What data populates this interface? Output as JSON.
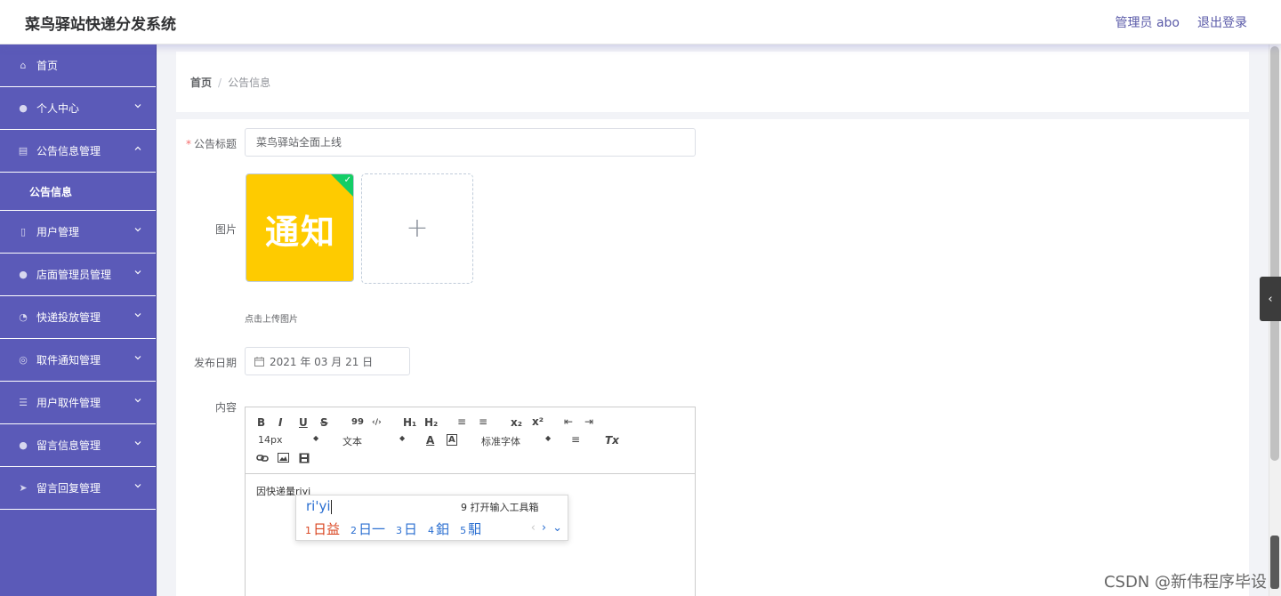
{
  "header": {
    "app_title": "菜鸟驿站快递分发系统",
    "user_label": "管理员 abo",
    "logout_label": "退出登录"
  },
  "sidebar": {
    "items": [
      {
        "label": "首页",
        "icon": "home-icon",
        "expanded": false,
        "has_caret": false
      },
      {
        "label": "个人中心",
        "icon": "user-icon",
        "expanded": false,
        "has_caret": true
      },
      {
        "label": "公告信息管理",
        "icon": "clipboard-icon",
        "expanded": true,
        "has_caret": true
      },
      {
        "label": "用户管理",
        "icon": "microphone-icon",
        "expanded": false,
        "has_caret": true
      },
      {
        "label": "店面管理员管理",
        "icon": "person-icon",
        "expanded": false,
        "has_caret": true
      },
      {
        "label": "快递投放管理",
        "icon": "gauge-icon",
        "expanded": false,
        "has_caret": true
      },
      {
        "label": "取件通知管理",
        "icon": "globe-icon",
        "expanded": false,
        "has_caret": true
      },
      {
        "label": "用户取件管理",
        "icon": "list-icon",
        "expanded": false,
        "has_caret": true
      },
      {
        "label": "留言信息管理",
        "icon": "location-icon",
        "expanded": false,
        "has_caret": true
      },
      {
        "label": "留言回复管理",
        "icon": "send-icon",
        "expanded": false,
        "has_caret": true
      }
    ],
    "subitem": "公告信息"
  },
  "breadcrumb": {
    "home": "首页",
    "separator": "/",
    "current": "公告信息"
  },
  "form": {
    "title_label": "公告标题",
    "required_mark": "*",
    "title_value": "菜鸟驿站全面上线",
    "image_label": "图片",
    "image_text": "通知",
    "upload_plus": "+",
    "upload_tip": "点击上传图片",
    "date_label": "发布日期",
    "date_value": "2021 年 03 月 21 日",
    "content_label": "内容",
    "accent_color": "#5b5ab8",
    "upload_success_color": "#13ce66",
    "thumb_color": "#fecb00"
  },
  "editor": {
    "toolbar": {
      "bold": "B",
      "italic": "I",
      "underline": "U",
      "strike": "S",
      "quote": "99",
      "code": "‹/›",
      "h1": "H₁",
      "h2": "H₂",
      "ordered_list": "≡",
      "bullet_list": "≡",
      "subscript": "x₂",
      "superscript": "x²",
      "outdent": "⇤",
      "indent": "⇥",
      "size": "14px",
      "header": "文本",
      "font": "标准字体",
      "align": "≡",
      "clean": "Tx"
    },
    "body_text": "因快递量riyi"
  },
  "ime": {
    "composition": "ri'yi",
    "tool_hint": "9 打开输入工具箱",
    "candidates": [
      {
        "n": "1",
        "text": "日益"
      },
      {
        "n": "2",
        "text": "日一"
      },
      {
        "n": "3",
        "text": "日"
      },
      {
        "n": "4",
        "text": "鈤"
      },
      {
        "n": "5",
        "text": "馹"
      }
    ]
  },
  "watermark": "CSDN @新伟程序毕设"
}
